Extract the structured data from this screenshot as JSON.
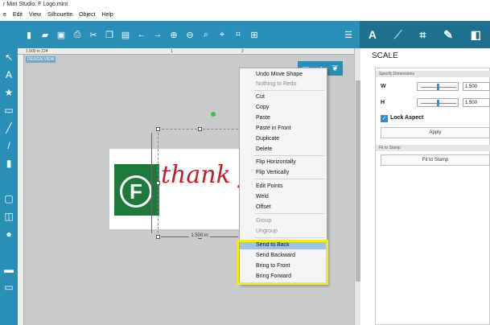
{
  "window": {
    "title": "r Mint Studio: F Logo.mint"
  },
  "menu": [
    "e",
    "Edit",
    "View",
    "Silhouette",
    "Object",
    "Help"
  ],
  "toolbar": {
    "icons": [
      "new-icon",
      "open-icon",
      "save-icon",
      "print-icon",
      "cut-icon",
      "copy-icon",
      "paste-icon",
      "undo-icon",
      "redo-icon",
      "zoom-in-icon",
      "zoom-out-icon",
      "zoom-select-icon",
      "zoom-fit-icon",
      "zoom-page-icon",
      "grid-icon"
    ]
  },
  "panel_tabs": {
    "text": "A",
    "scale": "⟋",
    "crop": "⌗",
    "fill": "✎",
    "more": "◧"
  },
  "ruler": {
    "tick_left": "1.500 in 224",
    "mark_1": "1",
    "mark_2": "2"
  },
  "canvas": {
    "design_view_label": "DESIGN VIEW",
    "dimension_label": "1.500 in"
  },
  "artwork": {
    "logo_letter": "F",
    "script_text": "thank yo"
  },
  "context_menu": {
    "items": [
      {
        "label": "Undo Move Shape",
        "enabled": true
      },
      {
        "label": "Nothing to Redo",
        "enabled": false
      },
      {
        "label": "Cut",
        "enabled": true
      },
      {
        "label": "Copy",
        "enabled": true
      },
      {
        "label": "Paste",
        "enabled": true
      },
      {
        "label": "Paste in Front",
        "enabled": true
      },
      {
        "label": "Duplicate",
        "enabled": true
      },
      {
        "label": "Delete",
        "enabled": true
      },
      {
        "label": "Flip Horizontally",
        "enabled": true
      },
      {
        "label": "Flip Vertically",
        "enabled": true
      },
      {
        "label": "Edit Points",
        "enabled": true
      },
      {
        "label": "Weld",
        "enabled": true
      },
      {
        "label": "Offset",
        "enabled": true
      },
      {
        "label": "Group",
        "enabled": false
      },
      {
        "label": "Ungroup",
        "enabled": false
      },
      {
        "label": "Send to Back",
        "enabled": true,
        "highlighted": true
      },
      {
        "label": "Send Backward",
        "enabled": true
      },
      {
        "label": "Bring to Front",
        "enabled": true
      },
      {
        "label": "Bring Forward",
        "enabled": true
      }
    ]
  },
  "scale_panel": {
    "title": "SCALE",
    "specify_dimensions": "Specify Dimensions",
    "w_label": "W",
    "h_label": "H",
    "w_value": "1.500",
    "h_value": "1.500",
    "lock_aspect": "Lock Aspect",
    "lock_aspect_checked": true,
    "apply": "Apply",
    "fit_to_stamp_header": "Fit to Stamp",
    "fit_to_stamp_button": "Fit to Stamp"
  },
  "colors": {
    "toolbar": "#2a8fb6",
    "canvas": "#c8cacb",
    "logo_green": "#1d7a3a",
    "script_red": "#c21e2a",
    "highlight": "#9cc4e8",
    "callout_yellow": "#f1ea1c"
  }
}
